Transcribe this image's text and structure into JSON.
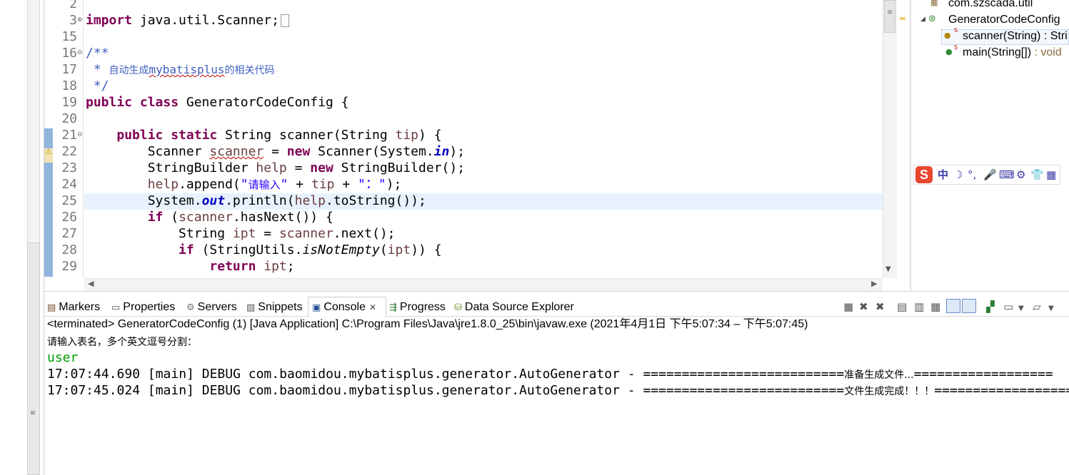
{
  "editor": {
    "lines": [
      {
        "n": "2"
      },
      {
        "n": "3"
      },
      {
        "n": "15"
      },
      {
        "n": "16"
      },
      {
        "n": "17"
      },
      {
        "n": "18"
      },
      {
        "n": "19"
      },
      {
        "n": "20"
      },
      {
        "n": "21"
      },
      {
        "n": "22"
      },
      {
        "n": "23"
      },
      {
        "n": "24"
      },
      {
        "n": "25"
      },
      {
        "n": "26"
      },
      {
        "n": "27"
      },
      {
        "n": "28"
      },
      {
        "n": "29"
      }
    ],
    "code": {
      "l3_kw": "import",
      "l3_rest": " java.util.Scanner;",
      "l16": "/**",
      "l17_star": " * ",
      "l17_cn1": "自动生成",
      "l17_en": "mybatisplus",
      "l17_cn2": "的相关代码",
      "l18": " */",
      "l19_kw": "public class",
      "l19_rest": " GeneratorCodeConfig {",
      "l21_kw": "public static",
      "l21_rest": " String scanner(String ",
      "l21_tip": "tip",
      "l21_end": ") {",
      "l22_a": "Scanner ",
      "l22_var": "scanner",
      "l22_eq": " = ",
      "l22_new": "new",
      "l22_b": " Scanner(System.",
      "l22_in": "in",
      "l22_end": ");",
      "l23_a": "StringBuilder ",
      "l23_var": "help",
      "l23_eq": " = ",
      "l23_new": "new",
      "l23_b": " StringBuilder();",
      "l24_help": "help",
      "l24_a": ".append(",
      "l24_q1": "\"",
      "l24_str1": "请输入",
      "l24_q2": "\"",
      "l24_plus": " + ",
      "l24_tip": "tip",
      "l24_plus2": " + ",
      "l24_str2": "\"：\"",
      "l24_end": ");",
      "l25_a": "System.",
      "l25_out": "out",
      "l25_b": ".println(",
      "l25_help": "help",
      "l25_c": ".toString());",
      "l26_kw": "if",
      "l26_a": " (",
      "l26_var": "scanner",
      "l26_b": ".hasNext()) {",
      "l27_a": "String ",
      "l27_var": "ipt",
      "l27_eq": " = ",
      "l27_sc": "scanner",
      "l27_b": ".next();",
      "l28_kw": "if",
      "l28_a": " (StringUtils.",
      "l28_m": "isNotEmpty",
      "l28_b": "(",
      "l28_var": "ipt",
      "l28_c": ")) {",
      "l29_kw": "return",
      "l29_var": " ipt",
      "l29_c": ";"
    }
  },
  "outline": {
    "package": "com.szscada.util",
    "class": "GeneratorCodeConfig",
    "method1": "scanner(String) : Stri",
    "method2_name": "main(String[])",
    "method2_ret": " : void"
  },
  "console": {
    "tabs": {
      "markers": "Markers",
      "properties": "Properties",
      "servers": "Servers",
      "snippets": "Snippets",
      "console": "Console",
      "progress": "Progress",
      "dse": "Data Source Explorer"
    },
    "status": "<terminated> GeneratorCodeConfig (1) [Java Application] C:\\Program Files\\Java\\jre1.8.0_25\\bin\\javaw.exe  (2021年4月1日 下午5:07:34 – 下午5:07:45)",
    "prompt": "请输入表名，多个英文逗号分割：",
    "input": "user",
    "log1_a": "17:07:44.690 [main] DEBUG com.baomidou.mybatisplus.generator.AutoGenerator - ==========================",
    "log1_cn": "准备生成文件...",
    "log1_b": "==================",
    "log2_a": "17:07:45.024 [main] DEBUG com.baomidou.mybatisplus.generator.AutoGenerator - ==========================",
    "log2_cn": "文件生成完成！！！",
    "log2_b": "=================="
  },
  "ime": {
    "logo": "S",
    "items": [
      "中",
      "☽",
      "°,",
      "🎤",
      "⌨",
      "⚙",
      "👕",
      "▦"
    ]
  }
}
